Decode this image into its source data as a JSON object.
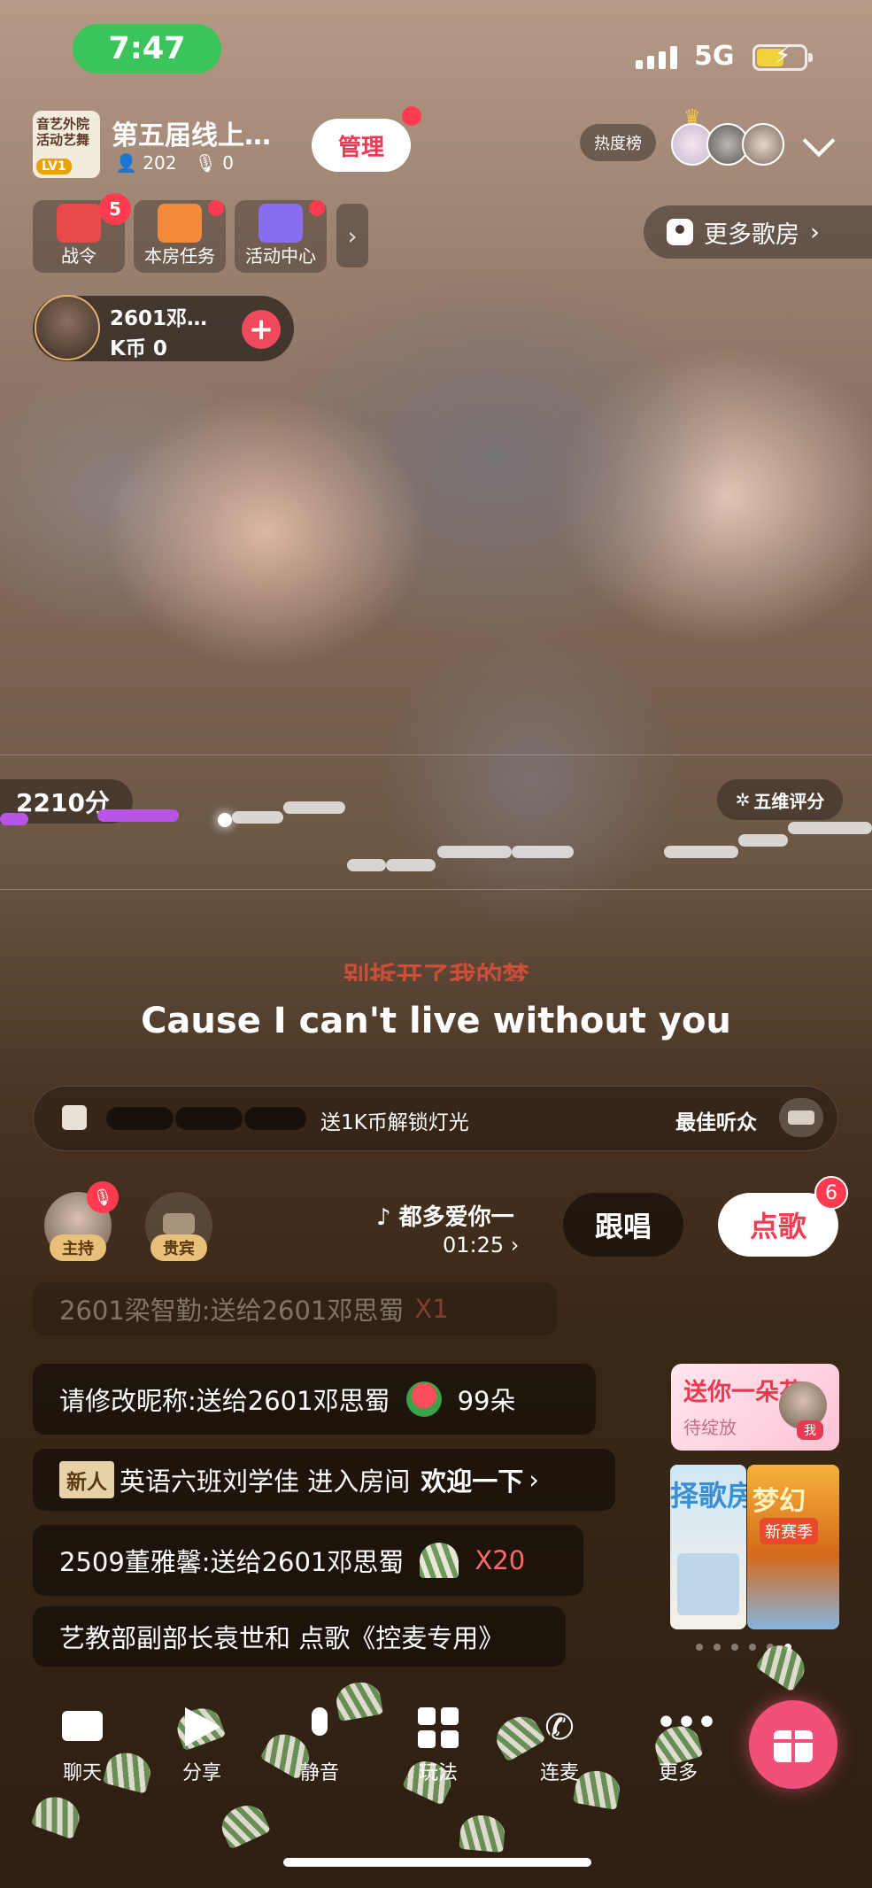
{
  "status_bar": {
    "time": "7:47",
    "network": "5G"
  },
  "room": {
    "thumb_text": "音艺外院 活动艺舞",
    "thumb_level": "LV1",
    "title": "第五届线上…",
    "listeners": "202",
    "mics": "0",
    "manage_label": "管理",
    "hot_rank_label": "热度榜"
  },
  "features": [
    {
      "label": "战令",
      "badge": "5",
      "color": "#e94a4a"
    },
    {
      "label": "本房任务",
      "color": "#f28a3a"
    },
    {
      "label": "活动中心",
      "color": "#8a6ef0"
    }
  ],
  "more_rooms_label": "更多歌房",
  "singer": {
    "name": "2601邓…",
    "coins": "K币 0"
  },
  "score": {
    "value": "2210分",
    "five_d_label": "五维评分"
  },
  "lyrics": {
    "previous": "别拆开了我的梦",
    "current": "Cause I can't live without you"
  },
  "light_bar": {
    "text": "送1K币解锁灯光",
    "best_listener": "最佳听众"
  },
  "seats": {
    "host_tag": "主持",
    "guest_tag": "贵宾"
  },
  "song": {
    "name": "都多爱你一",
    "time": "01:25 ›"
  },
  "controls": {
    "sing_along": "跟唱",
    "order_song": "点歌",
    "order_badge": "6"
  },
  "chat": {
    "faded": {
      "text": "2601梁智勤:送给2601邓思蜀",
      "extra": "X1"
    },
    "gift1": {
      "text": "请修改昵称:送给2601邓思蜀",
      "count": "99朵"
    },
    "join": {
      "tag": "新人",
      "text": "英语六班刘学佳 进入房间",
      "action": "欢迎一下"
    },
    "gift2": {
      "text": "2509董雅馨:送给2601邓思蜀",
      "count": "X20"
    },
    "order": {
      "text": "艺教部副部长袁世和 点歌《控麦专用》"
    }
  },
  "side_promos": {
    "gift_card": {
      "title": "送你一朵花",
      "status": "待绽放",
      "me": "我"
    },
    "promo1": "择歌房",
    "promo2": {
      "title": "梦幻",
      "sub": "新赛季"
    }
  },
  "bottom_bar": [
    {
      "label": "聊天",
      "icon": "chat-icon"
    },
    {
      "label": "分享",
      "icon": "share-icon"
    },
    {
      "label": "静音",
      "icon": "mute-mic-icon"
    },
    {
      "label": "玩法",
      "icon": "grid-icon"
    },
    {
      "label": "连麦",
      "icon": "phone-icon"
    },
    {
      "label": "更多",
      "icon": "more-icon"
    }
  ],
  "colors": {
    "accent_red": "#ff3b4f",
    "pitch_hit": "#b855e6",
    "status_green": "#3ac45a"
  }
}
